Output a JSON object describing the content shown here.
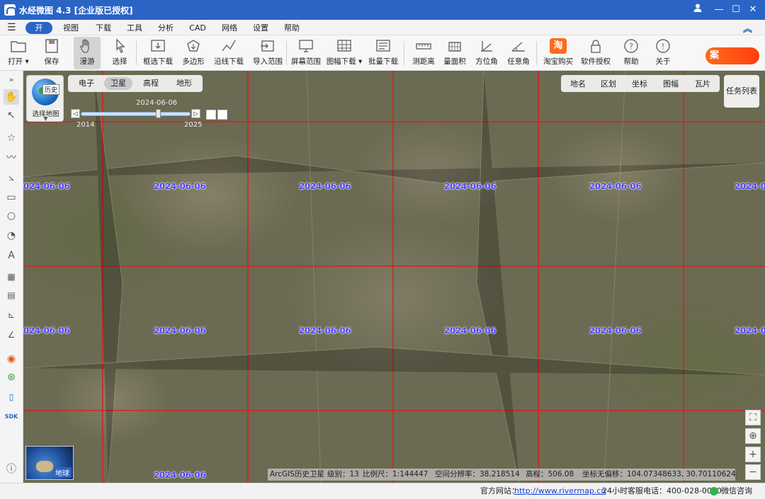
{
  "window": {
    "title": "水经微图 4.3 [企业版已授权]"
  },
  "menu": {
    "items": [
      "开始",
      "视图",
      "下载",
      "工具",
      "分析",
      "CAD",
      "网络",
      "设置",
      "帮助"
    ],
    "active": "开始"
  },
  "toolbar": {
    "tools": [
      {
        "label": "打开 ▾",
        "icon": "folder-icon"
      },
      {
        "label": "保存",
        "icon": "save-icon"
      },
      {
        "label": "漫游",
        "icon": "hand-icon",
        "selected": true
      },
      {
        "label": "选择",
        "icon": "pointer-icon"
      },
      {
        "label": "框选下载",
        "icon": "box-download-icon"
      },
      {
        "label": "多边形",
        "icon": "polygon-icon"
      },
      {
        "label": "沿线下载",
        "icon": "line-download-icon"
      },
      {
        "label": "导入范围",
        "icon": "import-icon"
      },
      {
        "label": "屏幕范围",
        "icon": "screen-icon"
      },
      {
        "label": "图幅下载 ▾",
        "icon": "sheet-icon"
      },
      {
        "label": "批量下载",
        "icon": "batch-icon"
      },
      {
        "label": "测距离",
        "icon": "ruler-icon"
      },
      {
        "label": "量面积",
        "icon": "area-icon"
      },
      {
        "label": "方位角",
        "icon": "azimuth-icon"
      },
      {
        "label": "任意角",
        "icon": "angle-icon"
      },
      {
        "label": "淘宝购买",
        "icon": "taobao-icon"
      },
      {
        "label": "软件授权",
        "icon": "lock-icon"
      },
      {
        "label": "帮助",
        "icon": "help-icon"
      },
      {
        "label": "关于",
        "icon": "info-icon"
      }
    ],
    "brand": "案"
  },
  "map_types": {
    "items": [
      "电子",
      "卫星",
      "高程",
      "地形"
    ],
    "active": "卫星"
  },
  "history": {
    "tag": "历史",
    "label": "选择地图"
  },
  "timeline": {
    "date": "2024-06-06",
    "start": "2014",
    "end": "2025"
  },
  "layer_bar": {
    "items": [
      "地名",
      "区划",
      "坐标",
      "图幅",
      "瓦片"
    ]
  },
  "task_list": "任务列表",
  "grid": {
    "date_label": "2024-06-06",
    "line_color": "#e11b1b"
  },
  "earth": {
    "label": "地球"
  },
  "status": {
    "source": "ArcGIS历史卫星",
    "level": "级别：13",
    "scale": "比例尺：1:144447",
    "resolution": "空间分辨率：38.218514",
    "elevation": "高程：506.08",
    "coords": "坐标无偏移：104.07348633, 30.70110624"
  },
  "footer": {
    "site_label": "官方网站：",
    "site_url": "http://www.rivermap.cn",
    "phone": "24小时客服电话：400-028-0050",
    "wechat": "微信咨询"
  },
  "colors": {
    "title_bar": "#2a64c5",
    "accent": "#2a64c5",
    "grid": "#e11b1b",
    "grid_label": "#4a40ff"
  }
}
